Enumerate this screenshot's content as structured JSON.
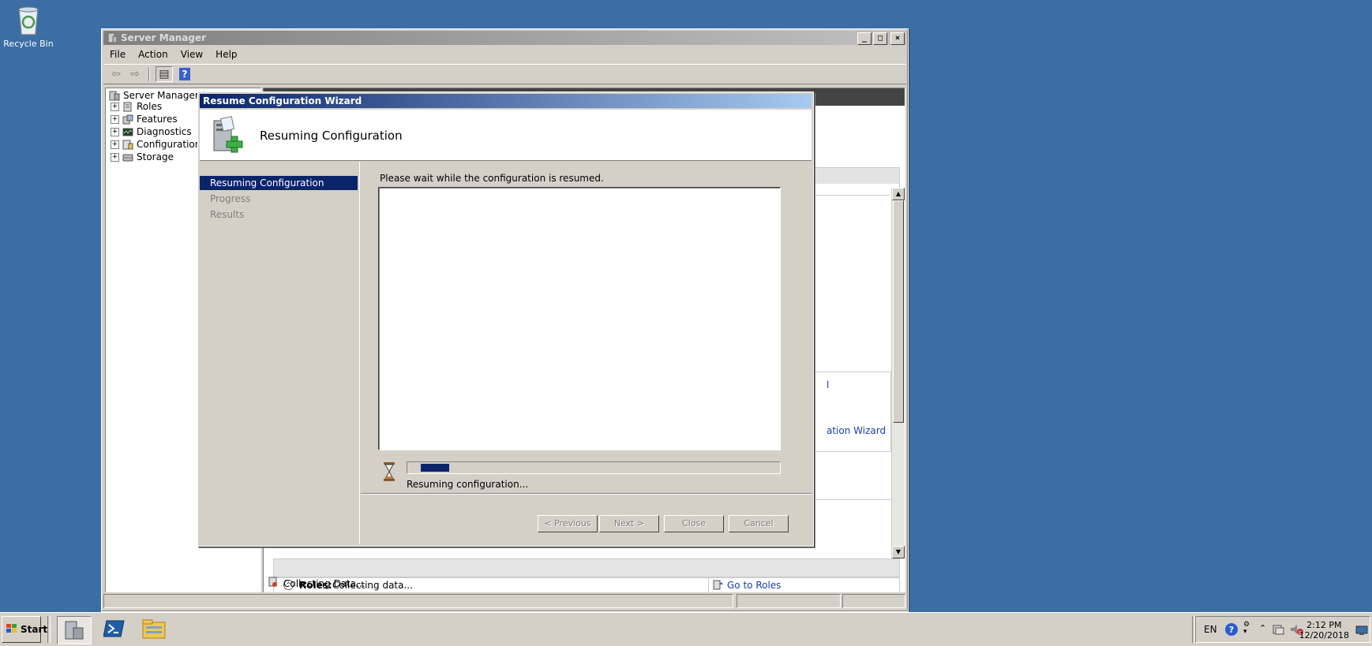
{
  "desktop": {
    "recycle_bin_label": "Recycle Bin"
  },
  "server_manager": {
    "title": "Server Manager",
    "caption_buttons": {
      "minimize": "_",
      "maximize": "□",
      "close": "×"
    },
    "menu": [
      "File",
      "Action",
      "View",
      "Help"
    ],
    "toolbar": {
      "back": "⇦",
      "forward": "⇨",
      "show_hide": "▤",
      "help": "?"
    },
    "tree": {
      "root": "Server Manager (IE",
      "items": [
        "Roles",
        "Features",
        "Diagnostics",
        "Configuration",
        "Storage"
      ]
    },
    "content": {
      "link_partial_1": "l",
      "link_partial_2": "ation Wizard",
      "roles_heading": "Roles:",
      "roles_status": "Collecting data...",
      "go_to_roles": "Go to Roles"
    },
    "collecting_data": "Collecting Data..."
  },
  "wizard": {
    "title": "Resume Configuration Wizard",
    "header_title": "Resuming Configuration",
    "nav": [
      {
        "label": "Resuming Configuration",
        "state": "active"
      },
      {
        "label": "Progress",
        "state": "disabled"
      },
      {
        "label": "Results",
        "state": "disabled"
      }
    ],
    "instruction": "Please wait while the configuration is resumed.",
    "progress_fraction": 0.08,
    "progress_text": "Resuming configuration...",
    "buttons": {
      "previous": "< Previous",
      "next": "Next >",
      "close": "Close",
      "cancel": "Cancel"
    }
  },
  "taskbar": {
    "start_label": "Start",
    "language": "EN",
    "time": "2:12 PM",
    "date": "12/20/2018"
  },
  "colors": {
    "desktop": "#3a6ea5",
    "active_title": "#0a246a",
    "chrome": "#d4d0c8"
  }
}
